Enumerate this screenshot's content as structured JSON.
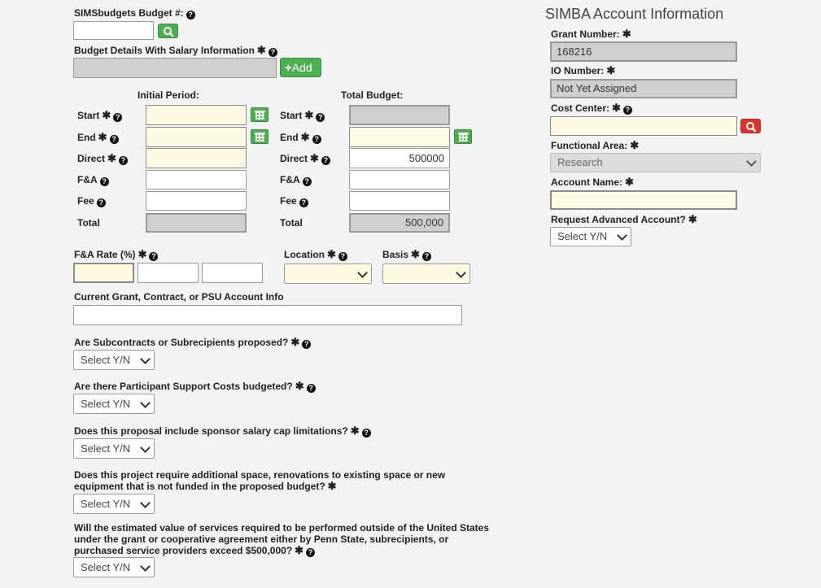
{
  "left": {
    "budget_num_label": "SIMSbudgets Budget #:",
    "budget_details_label": "Budget Details With Salary Information",
    "add_label": "Add",
    "initial_period_header": "Initial Period:",
    "total_budget_header": "Total Budget:",
    "start_label": "Start",
    "end_label": "End",
    "direct_label": "Direct",
    "fa_label": "F&A",
    "fee_label": "Fee",
    "total_label": "Total",
    "total_budget_direct": "500000",
    "total_budget_total": "500,000",
    "fa_rate_label": "F&A Rate (%)",
    "location_label": "Location",
    "basis_label": "Basis",
    "current_grant_label": "Current Grant, Contract, or PSU Account Info",
    "q_subcontracts": "Are Subcontracts or Subrecipients proposed?",
    "q_participant": "Are there Participant Support Costs budgeted?",
    "q_salary_cap": "Does this proposal include sponsor salary cap limitations?",
    "q_space_line1": "Does this project require additional space, renovations to existing space or new",
    "q_space_line2": "equipment that is not funded in the proposed budget?",
    "q_outside_line1": "Will the estimated value of services required to be performed outside of the United States",
    "q_outside_line2": "under the grant or cooperative agreement either by Penn State, subrecipients, or",
    "q_outside_line3": "purchased service providers exceed $500,000?",
    "select_yn": "Select Y/N"
  },
  "right": {
    "title": "SIMBA Account Information",
    "grant_number_label": "Grant Number:",
    "grant_number_value": "168216",
    "io_number_label": "IO Number:",
    "io_number_value": "Not Yet Assigned",
    "cost_center_label": "Cost Center:",
    "functional_area_label": "Functional Area:",
    "functional_area_value": "Research",
    "account_name_label": "Account Name:",
    "request_advanced_label": "Request Advanced Account?",
    "select_yn": "Select Y/N"
  },
  "colors": {
    "green_button": "#4caf50",
    "red_button": "#d9342b",
    "required_field": "#fffbe3",
    "readonly_field": "#cfcfcf"
  }
}
